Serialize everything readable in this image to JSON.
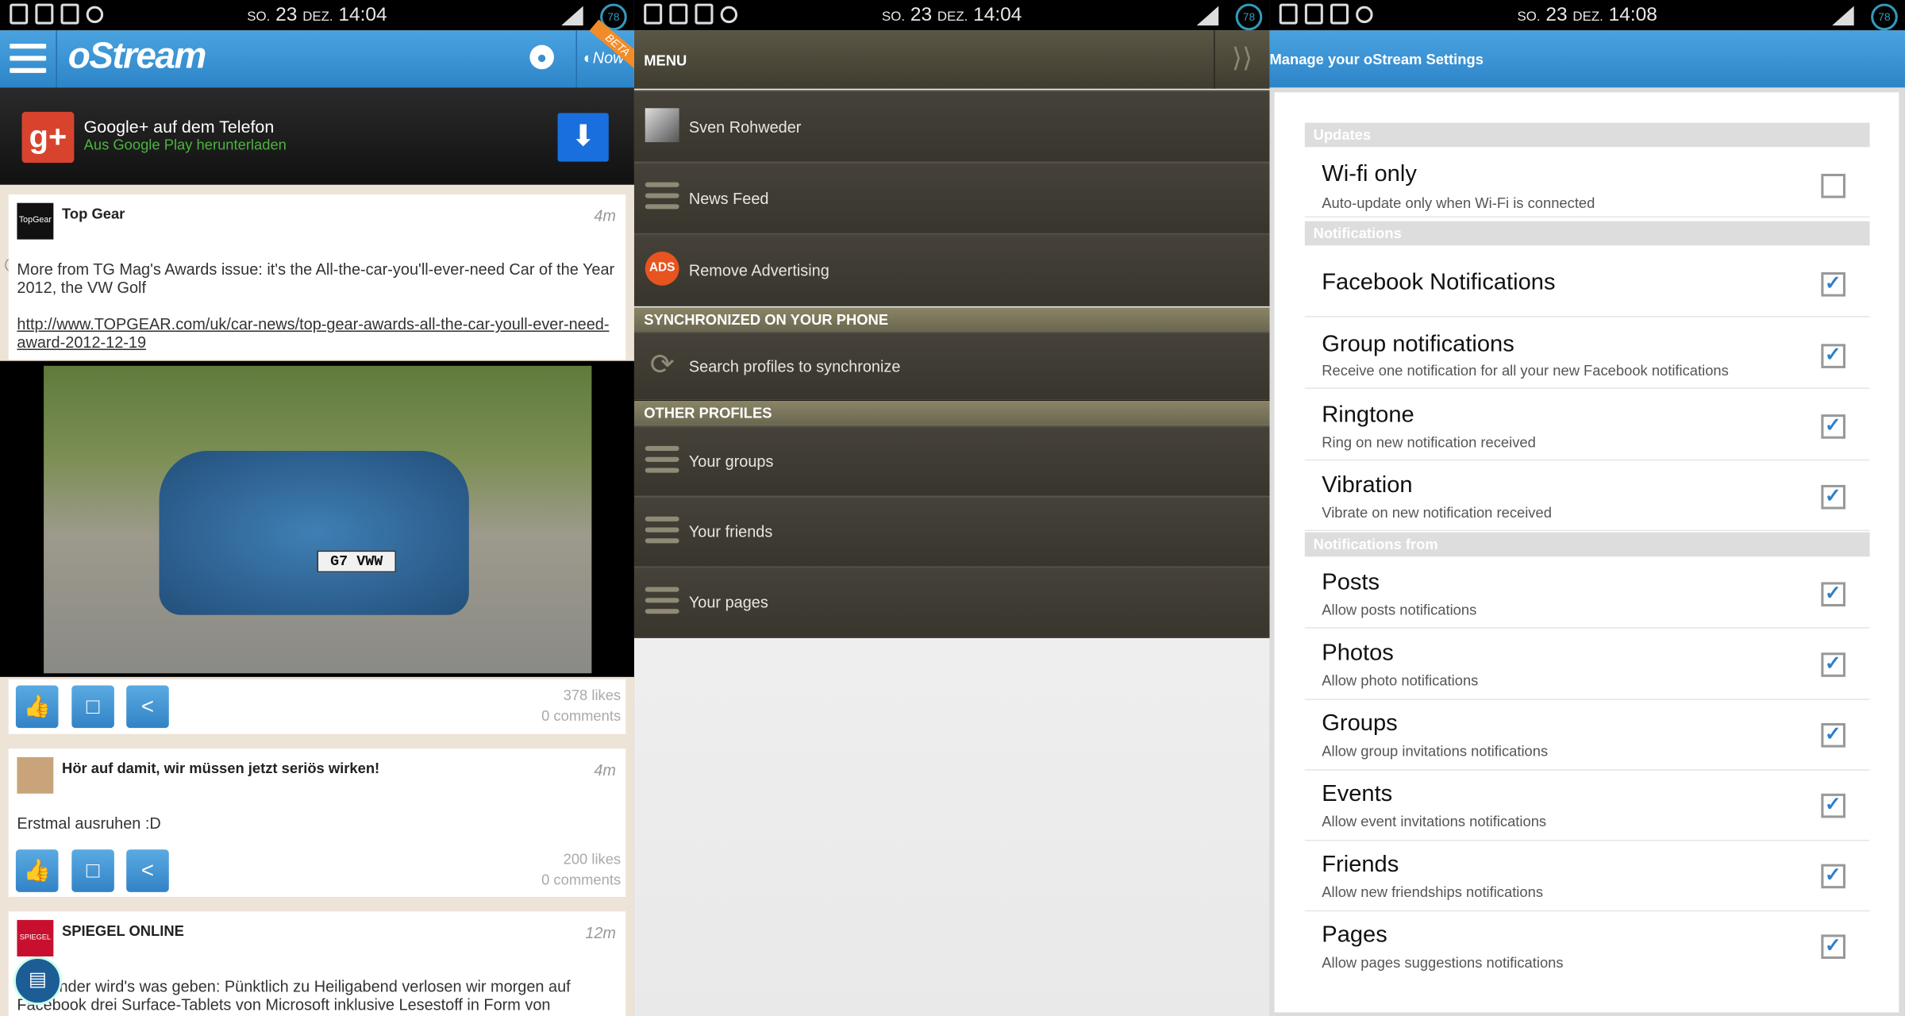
{
  "status_bars": [
    {
      "day": "SO.",
      "date": "23",
      "month": "DEZ.",
      "time": "14:04",
      "battery": "78"
    },
    {
      "day": "SO.",
      "date": "23",
      "month": "DEZ.",
      "time": "14:04",
      "battery": "78"
    },
    {
      "day": "SO.",
      "date": "23",
      "month": "DEZ.",
      "time": "14:08",
      "battery": "78"
    }
  ],
  "feed": {
    "app_title": "oStream",
    "now_label": "Now",
    "beta_label": "BETA",
    "ad": {
      "title": "Google+ auf dem Telefon",
      "subtitle": "Aus Google Play herunterladen",
      "logo": "g+"
    },
    "posts": [
      {
        "author": "Top Gear",
        "time": "4m",
        "text": "More from TG Mag's Awards issue: it's the All-the-car-you'll-ever-need Car of the Year 2012, the VW Golf",
        "link": "http://www.TOPGEAR.com/uk/car-news/top-gear-awards-all-the-car-youll-ever-need-award-2012-12-19",
        "likes": "378 likes",
        "comments": "0 comments",
        "plate": "G7 VWW"
      },
      {
        "author": "Hör auf damit, wir müssen jetzt seriös wirken!",
        "time": "4m",
        "text": "Erstmal ausruhen :D",
        "likes": "200 likes",
        "comments": "0 comments"
      },
      {
        "author": "SPIEGEL ONLINE",
        "time": "12m",
        "text": "Für Kinder wird's was geben: Pünktlich zu Heiligabend verlosen wir morgen auf Facebook drei Surface-Tablets von Microsoft inklusive Lesestoff in Form von"
      }
    ]
  },
  "menu": {
    "title": "MENU",
    "items": [
      {
        "label": "Sven Rohweder",
        "icon": "avatar"
      },
      {
        "label": "News Feed",
        "icon": "news-feed-icon"
      },
      {
        "label": "Remove Advertising",
        "icon": "no-ads-icon"
      }
    ],
    "sync_header": "SYNCHRONIZED ON YOUR PHONE",
    "sync_item": "Search profiles to synchronize",
    "other_header": "OTHER PROFILES",
    "other_items": [
      "Your groups",
      "Your friends",
      "Your pages"
    ]
  },
  "settings": {
    "title": "Manage your oStream Settings",
    "sections": [
      {
        "header": "Updates",
        "rows": [
          {
            "title": "Wi-fi only",
            "subtitle": "Auto-update only when Wi-Fi is connected",
            "checked": false
          }
        ]
      },
      {
        "header": "Notifications",
        "rows": [
          {
            "title": "Facebook Notifications",
            "subtitle": "",
            "checked": true
          },
          {
            "title": "Group notifications",
            "subtitle": "Receive one notification for all your new Facebook notifications",
            "checked": true
          },
          {
            "title": "Ringtone",
            "subtitle": "Ring on new notification received",
            "checked": true
          },
          {
            "title": "Vibration",
            "subtitle": "Vibrate on new notification received",
            "checked": true
          }
        ]
      },
      {
        "header": "Notifications from",
        "rows": [
          {
            "title": "Posts",
            "subtitle": "Allow posts notifications",
            "checked": true
          },
          {
            "title": "Photos",
            "subtitle": "Allow photo notifications",
            "checked": true
          },
          {
            "title": "Groups",
            "subtitle": "Allow group invitations notifications",
            "checked": true
          },
          {
            "title": "Events",
            "subtitle": "Allow event invitations notifications",
            "checked": true
          },
          {
            "title": "Friends",
            "subtitle": "Allow new friendships notifications",
            "checked": true
          },
          {
            "title": "Pages",
            "subtitle": "Allow pages suggestions notifications",
            "checked": true
          }
        ]
      }
    ]
  }
}
